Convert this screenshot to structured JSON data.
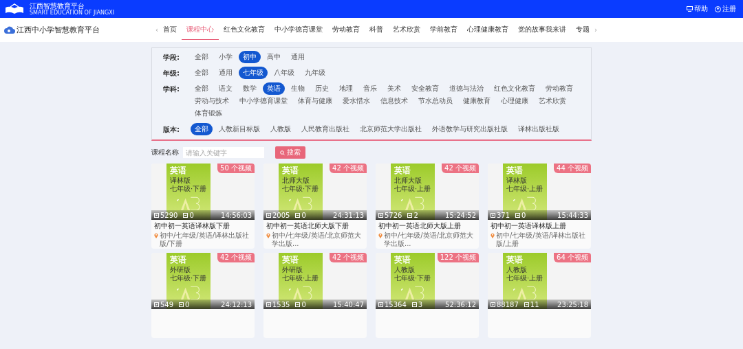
{
  "top_bar": {
    "brand": "江西智慧教育平台",
    "brand_sub": "SMART EDUCATION OF JIANGXI",
    "links": [
      "帮助",
      "注册"
    ]
  },
  "nav": {
    "logo": "江西中小学智慧教育平台",
    "prev": "‹",
    "next": "›",
    "items": [
      {
        "label": "首页",
        "selected": false
      },
      {
        "label": "课程中心",
        "selected": true
      },
      {
        "label": "红色文化教育",
        "selected": false
      },
      {
        "label": "中小学德育课堂",
        "selected": false
      },
      {
        "label": "劳动教育",
        "selected": false
      },
      {
        "label": "科普",
        "selected": false
      },
      {
        "label": "艺术欣赏",
        "selected": false
      },
      {
        "label": "学前教育",
        "selected": false
      },
      {
        "label": "心理健康教育",
        "selected": false
      },
      {
        "label": "党的故事我来讲",
        "selected": false
      },
      {
        "label": "专题",
        "selected": false
      }
    ]
  },
  "filters": [
    {
      "label": "学段:",
      "options": [
        {
          "label": "全部",
          "selected": false
        },
        {
          "label": "小学",
          "selected": false
        },
        {
          "label": "初中",
          "selected": true
        },
        {
          "label": "高中",
          "selected": false
        },
        {
          "label": "通用",
          "selected": false
        }
      ]
    },
    {
      "label": "年级:",
      "options": [
        {
          "label": "全部",
          "selected": false
        },
        {
          "label": "通用",
          "selected": false
        },
        {
          "label": "七年级",
          "selected": true
        },
        {
          "label": "八年级",
          "selected": false
        },
        {
          "label": "九年级",
          "selected": false
        }
      ]
    },
    {
      "label": "学科:",
      "options": [
        {
          "label": "全部",
          "selected": false
        },
        {
          "label": "语文",
          "selected": false
        },
        {
          "label": "数学",
          "selected": false
        },
        {
          "label": "英语",
          "selected": true
        },
        {
          "label": "生物",
          "selected": false
        },
        {
          "label": "历史",
          "selected": false
        },
        {
          "label": "地理",
          "selected": false
        },
        {
          "label": "音乐",
          "selected": false
        },
        {
          "label": "美术",
          "selected": false
        },
        {
          "label": "安全教育",
          "selected": false
        },
        {
          "label": "道德与法治",
          "selected": false
        },
        {
          "label": "红色文化教育",
          "selected": false
        },
        {
          "label": "劳动教育",
          "selected": false
        },
        {
          "label": "劳动与技术",
          "selected": false
        },
        {
          "label": "中小学德育课堂",
          "selected": false
        },
        {
          "label": "体育与健康",
          "selected": false
        },
        {
          "label": "爱水惜水",
          "selected": false
        },
        {
          "label": "信息技术",
          "selected": false
        },
        {
          "label": "节水总动员",
          "selected": false
        },
        {
          "label": "健康教育",
          "selected": false
        },
        {
          "label": "心理健康",
          "selected": false
        },
        {
          "label": "艺术欣赏",
          "selected": false
        },
        {
          "label": "体育锻炼",
          "selected": false
        }
      ]
    },
    {
      "label": "版本:",
      "options": [
        {
          "label": "全部",
          "selected": true
        },
        {
          "label": "人教新目标版",
          "selected": false
        },
        {
          "label": "人教版",
          "selected": false
        },
        {
          "label": "人民教育出版社",
          "selected": false
        },
        {
          "label": "北京师范大学出版社",
          "selected": false
        },
        {
          "label": "外语教学与研究出版社版",
          "selected": false
        },
        {
          "label": "译林出版社版",
          "selected": false
        }
      ]
    }
  ],
  "search": {
    "label": "课程名称",
    "placeholder": "请输入关键字",
    "button": "搜索"
  },
  "courses": [
    {
      "cover_subject": "英语",
      "cover_edition": "译林版",
      "cover_grade": "七年级·下册",
      "badge": "50 个视频",
      "views": "5290",
      "comments": "0",
      "duration": "14:56:03",
      "title": "初中初一英语译林版下册",
      "tags": "初中/七年级/英语/译林出版社版/下册"
    },
    {
      "cover_subject": "英语",
      "cover_edition": "北师大版",
      "cover_grade": "七年级·下册",
      "badge": "42 个视频",
      "views": "2005",
      "comments": "0",
      "duration": "24:31:13",
      "title": "初中初一英语北师大版下册",
      "tags": "初中/七年级/英语/北京师范大学出版..."
    },
    {
      "cover_subject": "英语",
      "cover_edition": "北师大版",
      "cover_grade": "七年级·上册",
      "badge": "42 个视频",
      "views": "5726",
      "comments": "2",
      "duration": "15:24:52",
      "title": "初中初一英语北师大版上册",
      "tags": "初中/七年级/英语/北京师范大学出版..."
    },
    {
      "cover_subject": "英语",
      "cover_edition": "译林版",
      "cover_grade": "七年级·上册",
      "badge": "44 个视频",
      "views": "371",
      "comments": "0",
      "duration": "15:44:33",
      "title": "初中初一英语译林版上册",
      "tags": "初中/七年级/英语/译林出版社版/上册"
    },
    {
      "cover_subject": "英语",
      "cover_edition": "外研版",
      "cover_grade": "七年级·下册",
      "badge": "42 个视频",
      "views": "549",
      "comments": "0",
      "duration": "24:12:13"
    },
    {
      "cover_subject": "英语",
      "cover_edition": "外研版",
      "cover_grade": "七年级·上册",
      "badge": "42 个视频",
      "views": "1535",
      "comments": "0",
      "duration": "15:40:47"
    },
    {
      "cover_subject": "英语",
      "cover_edition": "人教版",
      "cover_grade": "七年级·下册",
      "badge": "122 个视频",
      "views": "15364",
      "comments": "3",
      "duration": "52:36:12"
    },
    {
      "cover_subject": "英语",
      "cover_edition": "人教版",
      "cover_grade": "七年级·上册",
      "badge": "64 个视频",
      "views": "88187",
      "comments": "11",
      "duration": "23:25:18"
    }
  ]
}
